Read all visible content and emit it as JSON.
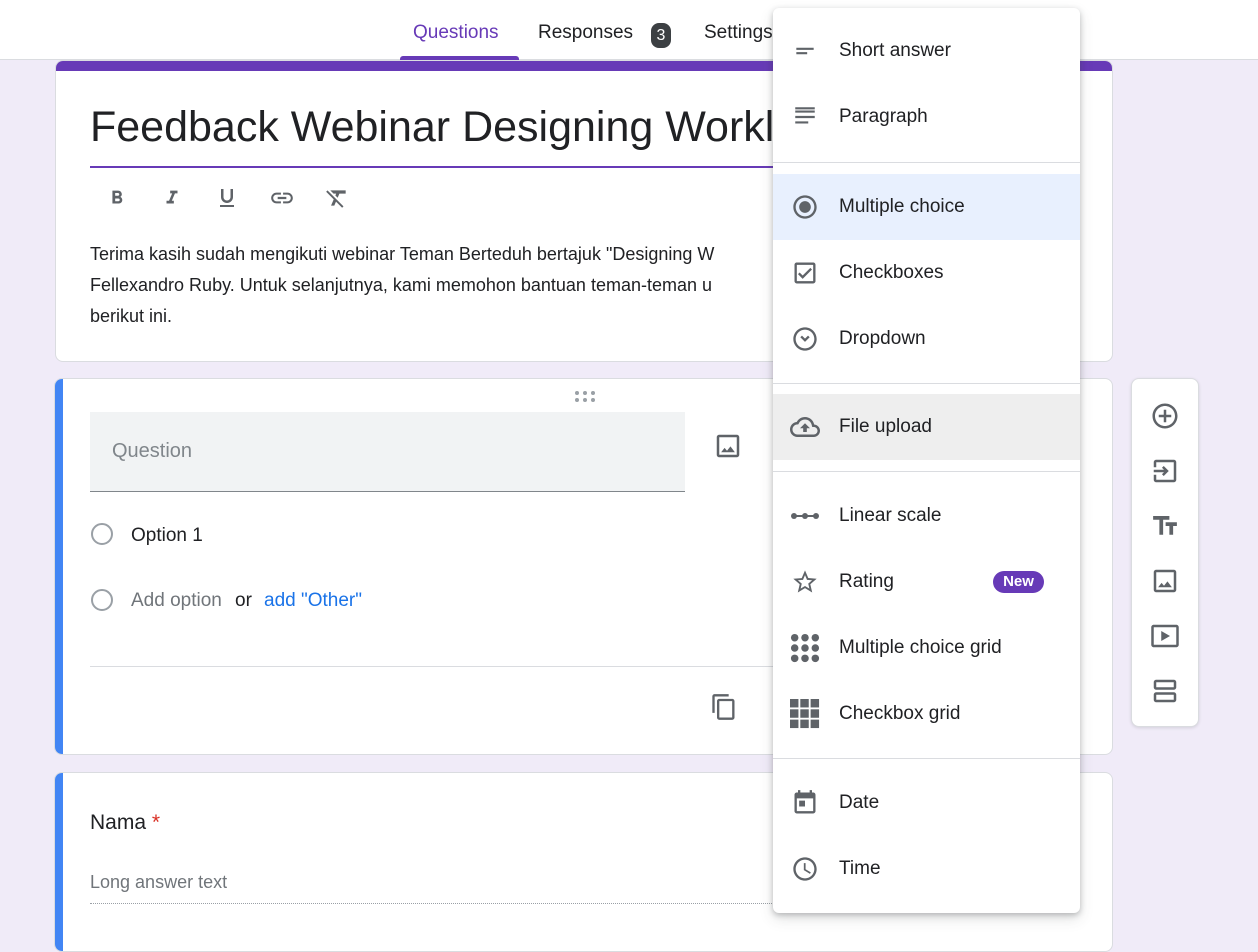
{
  "header": {
    "tabs": [
      {
        "label": "Questions",
        "active": true
      },
      {
        "label": "Responses",
        "badge": "3"
      },
      {
        "label": "Settings"
      }
    ]
  },
  "form": {
    "title": "Feedback Webinar Designing Workl",
    "description": "Terima kasih sudah mengikuti webinar Teman Berteduh bertajuk \"Designing W\nFellexandro Ruby. Untuk selanjutnya, kami memohon bantuan teman-teman u\nberikut ini.",
    "format_icons": [
      "bold-icon",
      "italic-icon",
      "underline-icon",
      "link-icon",
      "clear-format-icon"
    ]
  },
  "question_card": {
    "question_placeholder": "Question",
    "option1": "Option 1",
    "add_option": "Add option",
    "or": "or",
    "add_other": "add \"Other\""
  },
  "nama_card": {
    "label": "Nama",
    "required_mark": "*",
    "placeholder": "Long answer text"
  },
  "menu": {
    "items": [
      {
        "label": "Short answer",
        "icon": "short-answer-icon"
      },
      {
        "label": "Paragraph",
        "icon": "paragraph-icon"
      },
      {
        "label": "Multiple choice",
        "icon": "radio-icon",
        "selected": true
      },
      {
        "label": "Checkboxes",
        "icon": "checkbox-icon"
      },
      {
        "label": "Dropdown",
        "icon": "dropdown-icon"
      },
      {
        "label": "File upload",
        "icon": "cloud-upload-icon",
        "hovered": true
      },
      {
        "label": "Linear scale",
        "icon": "linear-scale-icon"
      },
      {
        "label": "Rating",
        "icon": "star-icon",
        "badge": "New"
      },
      {
        "label": "Multiple choice grid",
        "icon": "dot-grid-icon"
      },
      {
        "label": "Checkbox grid",
        "icon": "checkbox-grid-icon"
      },
      {
        "label": "Date",
        "icon": "calendar-icon"
      },
      {
        "label": "Time",
        "icon": "clock-icon"
      }
    ]
  },
  "toolbar": {
    "icons": [
      "add-question-icon",
      "import-questions-icon",
      "add-title-icon",
      "add-image-icon",
      "add-video-icon",
      "add-section-icon"
    ]
  },
  "colors": {
    "accent": "#673ab7",
    "question_accent": "#4285f4",
    "background": "#f0ebf8",
    "link": "#1a73e8"
  }
}
